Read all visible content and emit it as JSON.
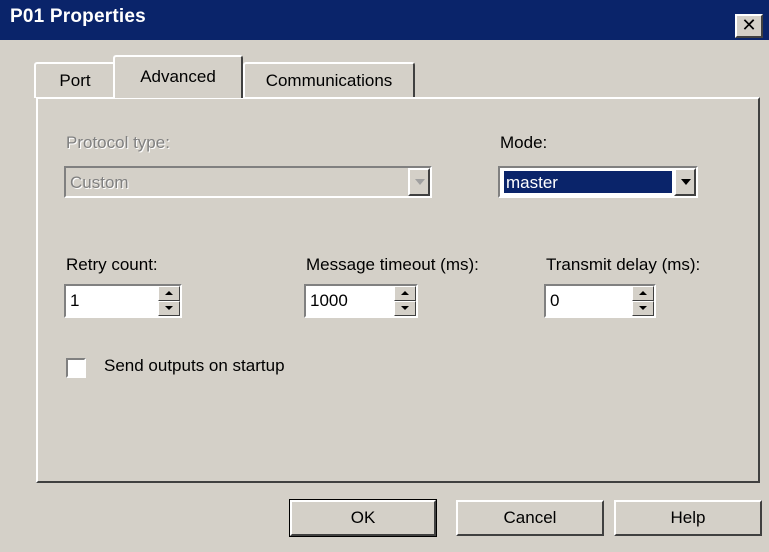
{
  "window": {
    "title": "P01 Properties",
    "close_glyph": "✕"
  },
  "tabs": [
    {
      "label": "Port"
    },
    {
      "label": "Advanced"
    },
    {
      "label": "Communications"
    }
  ],
  "fields": {
    "protocol_type": {
      "label": "Protocol type:",
      "value": "Custom",
      "enabled": false
    },
    "mode": {
      "label": "Mode:",
      "value": "master"
    },
    "retry_count": {
      "label": "Retry count:",
      "value": "1"
    },
    "message_timeout": {
      "label": "Message timeout (ms):",
      "value": "1000"
    },
    "transmit_delay": {
      "label": "Transmit delay (ms):",
      "value": "0"
    }
  },
  "checkbox": {
    "label": "Send outputs on startup",
    "checked": false
  },
  "buttons": {
    "ok": "OK",
    "cancel": "Cancel",
    "help": "Help"
  },
  "colors": {
    "titlebar": "#0a246a",
    "face": "#d4d0c8",
    "selection": "#0a246a"
  }
}
